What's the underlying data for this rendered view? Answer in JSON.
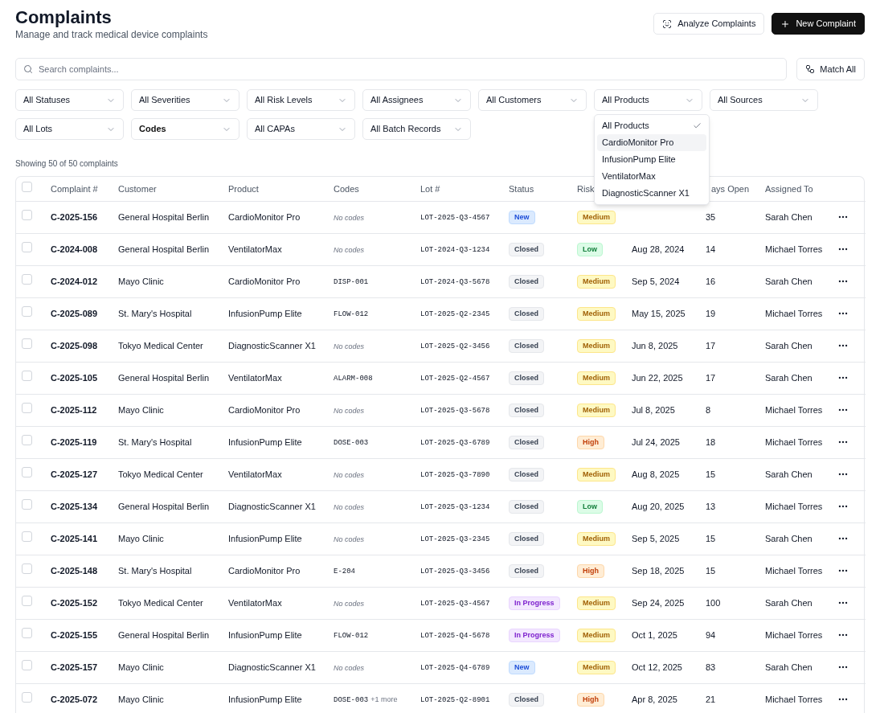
{
  "header": {
    "title": "Complaints",
    "subtitle": "Manage and track medical device complaints",
    "buttons": [
      {
        "label": "Analyze Complaints",
        "kind": "outline"
      },
      {
        "label": "New Complaint",
        "kind": "primary"
      }
    ]
  },
  "search": {
    "placeholder": "Search complaints..."
  },
  "match_button": {
    "label": "Match All"
  },
  "filters": [
    {
      "label": "All Statuses",
      "active": false
    },
    {
      "label": "All Severities",
      "active": false
    },
    {
      "label": "All Risk Levels",
      "active": false
    },
    {
      "label": "All Assignees",
      "active": false
    },
    {
      "label": "All Customers",
      "active": false
    },
    {
      "label": "All Products",
      "active": false,
      "options": [
        {
          "label": "All Products",
          "checked": true,
          "highlighted": false
        },
        {
          "label": "CardioMonitor Pro",
          "checked": false,
          "highlighted": true
        },
        {
          "label": "InfusionPump Elite",
          "checked": false,
          "highlighted": false
        },
        {
          "label": "VentilatorMax",
          "checked": false,
          "highlighted": false
        },
        {
          "label": "DiagnosticScanner X1",
          "checked": false,
          "highlighted": false
        }
      ]
    },
    {
      "label": "All Sources",
      "active": false
    },
    {
      "label": "All Lots",
      "active": false
    },
    {
      "label": "Codes",
      "active": true
    },
    {
      "label": "All CAPAs",
      "active": false
    },
    {
      "label": "All Batch Records",
      "active": false
    }
  ],
  "summary": "Showing 50 of 50 complaints",
  "table": {
    "header_checked": false,
    "columns": [
      "Complaint #",
      "Customer",
      "Product",
      "Codes",
      "Lot #",
      "Status",
      "Risk",
      "",
      "ays Open",
      "Assigned To"
    ],
    "rows": [
      {
        "checked": false,
        "id": "C-2025-156",
        "customer": "General Hospital Berlin",
        "product": "CardioMonitor Pro",
        "codes": {
          "kind": "empty",
          "text": "No codes"
        },
        "lot": "LOT-2025-Q3-4567",
        "status": {
          "kind": "new",
          "label": "New"
        },
        "risk": {
          "kind": "medium",
          "label": "Medium"
        },
        "days": "35",
        "assignee": "Sarah Chen"
      },
      {
        "checked": false,
        "id": "C-2024-008",
        "customer": "General Hospital Berlin",
        "product": "VentilatorMax",
        "codes": {
          "kind": "empty",
          "text": "No codes"
        },
        "lot": "LOT-2024-Q3-1234",
        "status": {
          "kind": "closed",
          "label": "Closed"
        },
        "risk": {
          "kind": "low",
          "label": "Low"
        },
        "date": "Aug 28, 2024",
        "days": "14",
        "assignee": "Michael Torres"
      },
      {
        "checked": false,
        "id": "C-2024-012",
        "customer": "Mayo Clinic",
        "product": "CardioMonitor Pro",
        "codes": {
          "kind": "code",
          "text": "DISP-001"
        },
        "lot": "LOT-2024-Q3-5678",
        "status": {
          "kind": "closed",
          "label": "Closed"
        },
        "risk": {
          "kind": "medium",
          "label": "Medium"
        },
        "date": "Sep 5, 2024",
        "days": "16",
        "assignee": "Sarah Chen"
      },
      {
        "checked": false,
        "id": "C-2025-089",
        "customer": "St. Mary's Hospital",
        "product": "InfusionPump Elite",
        "codes": {
          "kind": "code",
          "text": "FLOW-012"
        },
        "lot": "LOT-2025-Q2-2345",
        "status": {
          "kind": "closed",
          "label": "Closed"
        },
        "risk": {
          "kind": "medium",
          "label": "Medium"
        },
        "date": "May 15, 2025",
        "days": "19",
        "assignee": "Michael Torres"
      },
      {
        "checked": false,
        "id": "C-2025-098",
        "customer": "Tokyo Medical Center",
        "product": "DiagnosticScanner X1",
        "codes": {
          "kind": "empty",
          "text": "No codes"
        },
        "lot": "LOT-2025-Q2-3456",
        "status": {
          "kind": "closed",
          "label": "Closed"
        },
        "risk": {
          "kind": "medium",
          "label": "Medium"
        },
        "date": "Jun 8, 2025",
        "days": "17",
        "assignee": "Sarah Chen"
      },
      {
        "checked": false,
        "id": "C-2025-105",
        "customer": "General Hospital Berlin",
        "product": "VentilatorMax",
        "codes": {
          "kind": "code",
          "text": "ALARM-008"
        },
        "lot": "LOT-2025-Q2-4567",
        "status": {
          "kind": "closed",
          "label": "Closed"
        },
        "risk": {
          "kind": "medium",
          "label": "Medium"
        },
        "date": "Jun 22, 2025",
        "days": "17",
        "assignee": "Sarah Chen"
      },
      {
        "checked": false,
        "id": "C-2025-112",
        "customer": "Mayo Clinic",
        "product": "CardioMonitor Pro",
        "codes": {
          "kind": "empty",
          "text": "No codes"
        },
        "lot": "LOT-2025-Q3-5678",
        "status": {
          "kind": "closed",
          "label": "Closed"
        },
        "risk": {
          "kind": "medium",
          "label": "Medium"
        },
        "date": "Jul 8, 2025",
        "days": "8",
        "assignee": "Michael Torres"
      },
      {
        "checked": false,
        "id": "C-2025-119",
        "customer": "St. Mary's Hospital",
        "product": "InfusionPump Elite",
        "codes": {
          "kind": "code",
          "text": "DOSE-003"
        },
        "lot": "LOT-2025-Q3-6789",
        "status": {
          "kind": "closed",
          "label": "Closed"
        },
        "risk": {
          "kind": "high",
          "label": "High"
        },
        "date": "Jul 24, 2025",
        "days": "18",
        "assignee": "Michael Torres"
      },
      {
        "checked": false,
        "id": "C-2025-127",
        "customer": "Tokyo Medical Center",
        "product": "VentilatorMax",
        "codes": {
          "kind": "empty",
          "text": "No codes"
        },
        "lot": "LOT-2025-Q3-7890",
        "status": {
          "kind": "closed",
          "label": "Closed"
        },
        "risk": {
          "kind": "medium",
          "label": "Medium"
        },
        "date": "Aug 8, 2025",
        "days": "15",
        "assignee": "Sarah Chen"
      },
      {
        "checked": false,
        "id": "C-2025-134",
        "customer": "General Hospital Berlin",
        "product": "DiagnosticScanner X1",
        "codes": {
          "kind": "empty",
          "text": "No codes"
        },
        "lot": "LOT-2025-Q3-1234",
        "status": {
          "kind": "closed",
          "label": "Closed"
        },
        "risk": {
          "kind": "low",
          "label": "Low"
        },
        "date": "Aug 20, 2025",
        "days": "13",
        "assignee": "Michael Torres"
      },
      {
        "checked": false,
        "id": "C-2025-141",
        "customer": "Mayo Clinic",
        "product": "InfusionPump Elite",
        "codes": {
          "kind": "empty",
          "text": "No codes"
        },
        "lot": "LOT-2025-Q3-2345",
        "status": {
          "kind": "closed",
          "label": "Closed"
        },
        "risk": {
          "kind": "medium",
          "label": "Medium"
        },
        "date": "Sep 5, 2025",
        "days": "15",
        "assignee": "Sarah Chen"
      },
      {
        "checked": false,
        "id": "C-2025-148",
        "customer": "St. Mary's Hospital",
        "product": "CardioMonitor Pro",
        "codes": {
          "kind": "code",
          "text": "E-204"
        },
        "lot": "LOT-2025-Q3-3456",
        "status": {
          "kind": "closed",
          "label": "Closed"
        },
        "risk": {
          "kind": "high",
          "label": "High"
        },
        "date": "Sep 18, 2025",
        "days": "15",
        "assignee": "Michael Torres"
      },
      {
        "checked": false,
        "id": "C-2025-152",
        "customer": "Tokyo Medical Center",
        "product": "VentilatorMax",
        "codes": {
          "kind": "empty",
          "text": "No codes"
        },
        "lot": "LOT-2025-Q3-4567",
        "status": {
          "kind": "in_progress",
          "label": "In Progress"
        },
        "risk": {
          "kind": "medium",
          "label": "Medium"
        },
        "date": "Sep 24, 2025",
        "days": "100",
        "assignee": "Sarah Chen"
      },
      {
        "checked": false,
        "id": "C-2025-155",
        "customer": "General Hospital Berlin",
        "product": "InfusionPump Elite",
        "codes": {
          "kind": "code",
          "text": "FLOW-012"
        },
        "lot": "LOT-2025-Q4-5678",
        "status": {
          "kind": "in_progress",
          "label": "In Progress"
        },
        "risk": {
          "kind": "medium",
          "label": "Medium"
        },
        "date": "Oct 1, 2025",
        "days": "94",
        "assignee": "Michael Torres"
      },
      {
        "checked": false,
        "id": "C-2025-157",
        "customer": "Mayo Clinic",
        "product": "DiagnosticScanner X1",
        "codes": {
          "kind": "empty",
          "text": "No codes"
        },
        "lot": "LOT-2025-Q4-6789",
        "status": {
          "kind": "new",
          "label": "New"
        },
        "risk": {
          "kind": "medium",
          "label": "Medium"
        },
        "date": "Oct 12, 2025",
        "days": "83",
        "assignee": "Sarah Chen"
      },
      {
        "checked": false,
        "id": "C-2025-072",
        "customer": "Mayo Clinic",
        "product": "InfusionPump Elite",
        "codes": {
          "kind": "code",
          "text": "DOSE-003",
          "more": "+1 more"
        },
        "lot": "LOT-2025-Q2-8901",
        "status": {
          "kind": "closed",
          "label": "Closed"
        },
        "risk": {
          "kind": "high",
          "label": "High"
        },
        "date": "Apr 8, 2025",
        "days": "21",
        "assignee": "Michael Torres"
      }
    ]
  }
}
